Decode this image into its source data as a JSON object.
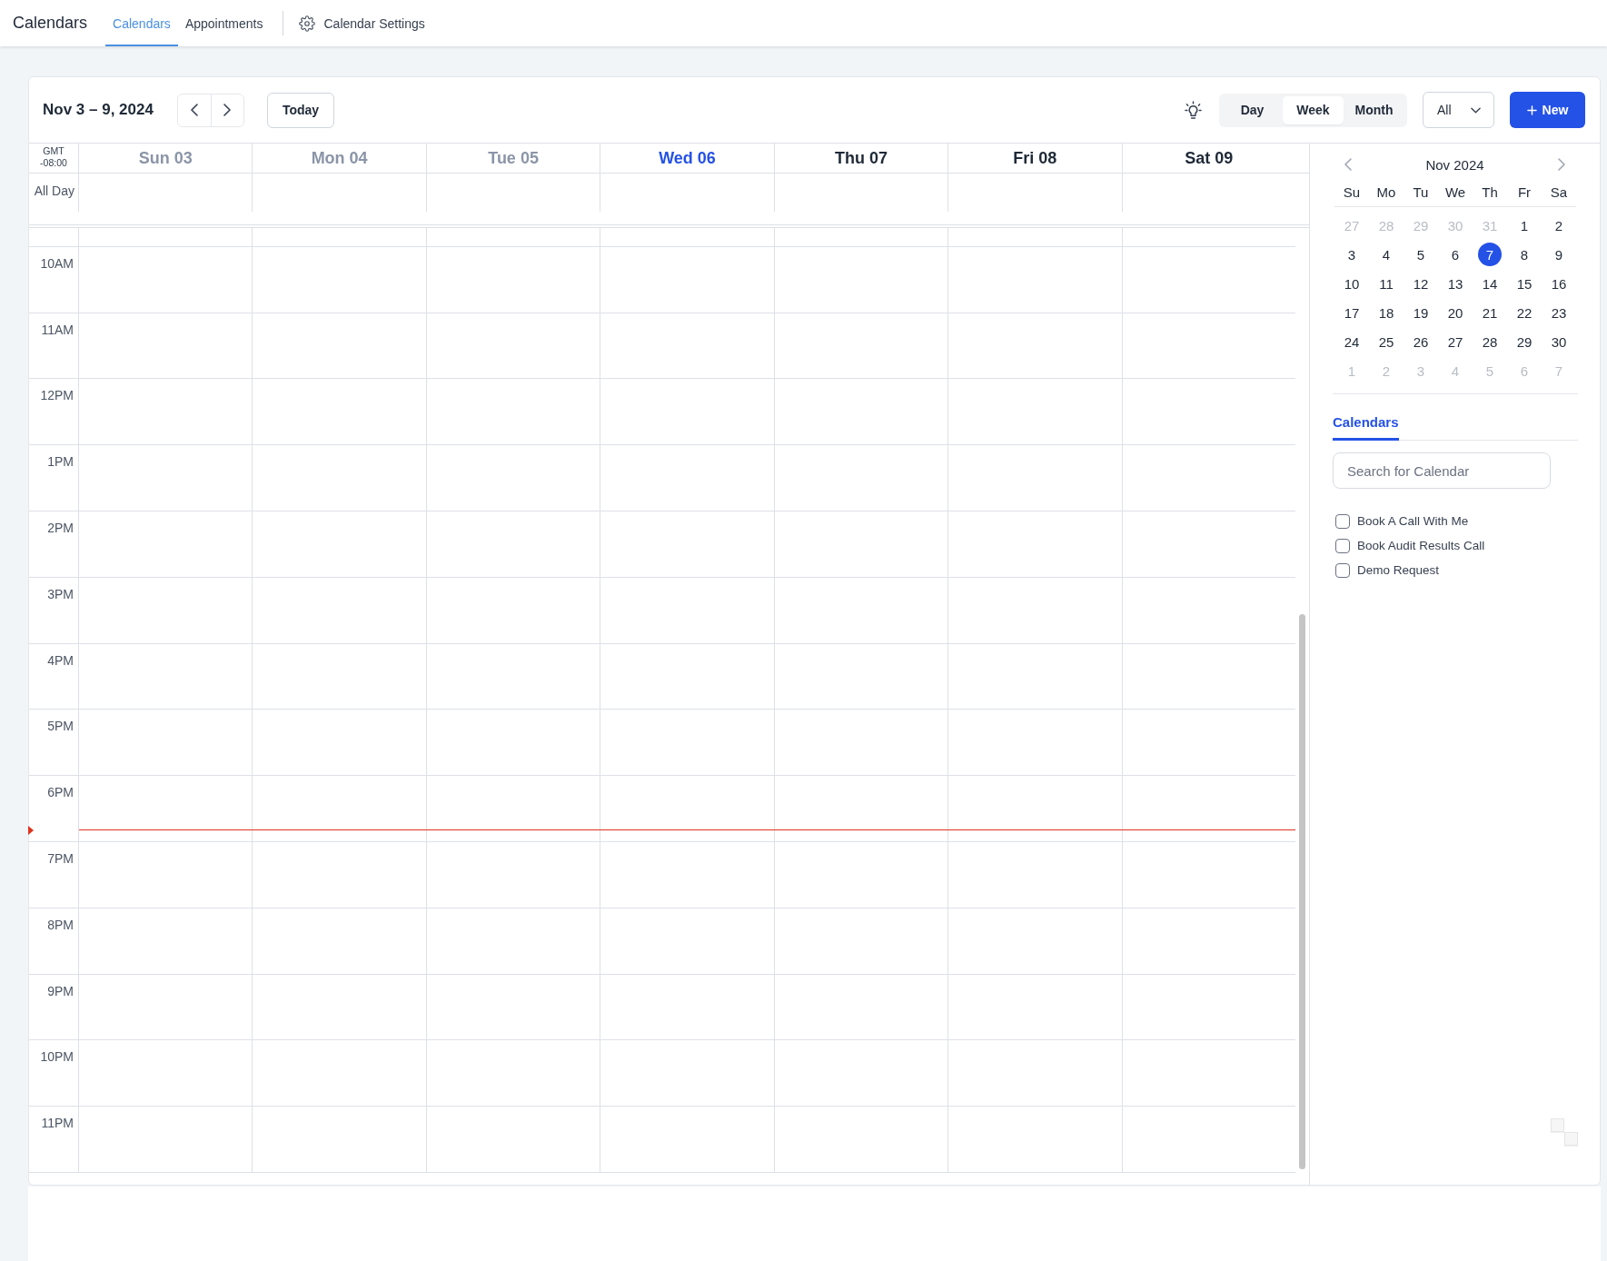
{
  "top_bar": {
    "title": "Calendars",
    "tabs": [
      {
        "label": "Calendars",
        "selected": true
      },
      {
        "label": "Appointments",
        "selected": false
      }
    ],
    "settings_link": {
      "label": "Calendar Settings"
    }
  },
  "toolbar": {
    "date_range": "Nov 3 – 9, 2024",
    "today_button": "Today",
    "views": [
      {
        "label": "Day",
        "selected": false
      },
      {
        "label": "Week",
        "selected": true
      },
      {
        "label": "Month",
        "selected": false
      }
    ],
    "filter": {
      "value": "All"
    },
    "new_button": "New"
  },
  "week_grid": {
    "timezone": {
      "name": "GMT",
      "offset": "-08:00"
    },
    "all_day_label": "All Day",
    "days": [
      {
        "label": "Sun 03",
        "past": true,
        "today": false
      },
      {
        "label": "Mon 04",
        "past": true,
        "today": false
      },
      {
        "label": "Tue 05",
        "past": true,
        "today": false
      },
      {
        "label": "Wed 06",
        "past": false,
        "today": true
      },
      {
        "label": "Thu 07",
        "past": false,
        "today": false
      },
      {
        "label": "Fri 08",
        "past": false,
        "today": false
      },
      {
        "label": "Sat 09",
        "past": false,
        "today": false
      }
    ],
    "hours": [
      {
        "label": "10AM",
        "now_line": false
      },
      {
        "label": "11AM",
        "now_line": false
      },
      {
        "label": "12PM",
        "now_line": false
      },
      {
        "label": "1PM",
        "now_line": false
      },
      {
        "label": "2PM",
        "now_line": false
      },
      {
        "label": "3PM",
        "now_line": false
      },
      {
        "label": "4PM",
        "now_line": false
      },
      {
        "label": "5PM",
        "now_line": false
      },
      {
        "label": "6PM",
        "now_line": true
      },
      {
        "label": "7PM",
        "now_line": false
      },
      {
        "label": "8PM",
        "now_line": false
      },
      {
        "label": "9PM",
        "now_line": false
      },
      {
        "label": "10PM",
        "now_line": false
      },
      {
        "label": "11PM",
        "now_line": false
      }
    ]
  },
  "mini_calendar": {
    "month": "Nov 2024",
    "weekdays": [
      "Su",
      "Mo",
      "Tu",
      "We",
      "Th",
      "Fr",
      "Sa"
    ],
    "weeks": [
      [
        {
          "label": "27",
          "outside": true,
          "selected": false
        },
        {
          "label": "28",
          "outside": true,
          "selected": false
        },
        {
          "label": "29",
          "outside": true,
          "selected": false
        },
        {
          "label": "30",
          "outside": true,
          "selected": false
        },
        {
          "label": "31",
          "outside": true,
          "selected": false
        },
        {
          "label": "1",
          "outside": false,
          "selected": false
        },
        {
          "label": "2",
          "outside": false,
          "selected": false
        }
      ],
      [
        {
          "label": "3",
          "outside": false,
          "selected": false
        },
        {
          "label": "4",
          "outside": false,
          "selected": false
        },
        {
          "label": "5",
          "outside": false,
          "selected": false
        },
        {
          "label": "6",
          "outside": false,
          "selected": false
        },
        {
          "label": "7",
          "outside": false,
          "selected": true
        },
        {
          "label": "8",
          "outside": false,
          "selected": false
        },
        {
          "label": "9",
          "outside": false,
          "selected": false
        }
      ],
      [
        {
          "label": "10",
          "outside": false,
          "selected": false
        },
        {
          "label": "11",
          "outside": false,
          "selected": false
        },
        {
          "label": "12",
          "outside": false,
          "selected": false
        },
        {
          "label": "13",
          "outside": false,
          "selected": false
        },
        {
          "label": "14",
          "outside": false,
          "selected": false
        },
        {
          "label": "15",
          "outside": false,
          "selected": false
        },
        {
          "label": "16",
          "outside": false,
          "selected": false
        }
      ],
      [
        {
          "label": "17",
          "outside": false,
          "selected": false
        },
        {
          "label": "18",
          "outside": false,
          "selected": false
        },
        {
          "label": "19",
          "outside": false,
          "selected": false
        },
        {
          "label": "20",
          "outside": false,
          "selected": false
        },
        {
          "label": "21",
          "outside": false,
          "selected": false
        },
        {
          "label": "22",
          "outside": false,
          "selected": false
        },
        {
          "label": "23",
          "outside": false,
          "selected": false
        }
      ],
      [
        {
          "label": "24",
          "outside": false,
          "selected": false
        },
        {
          "label": "25",
          "outside": false,
          "selected": false
        },
        {
          "label": "26",
          "outside": false,
          "selected": false
        },
        {
          "label": "27",
          "outside": false,
          "selected": false
        },
        {
          "label": "28",
          "outside": false,
          "selected": false
        },
        {
          "label": "29",
          "outside": false,
          "selected": false
        },
        {
          "label": "30",
          "outside": false,
          "selected": false
        }
      ],
      [
        {
          "label": "1",
          "outside": true,
          "selected": false
        },
        {
          "label": "2",
          "outside": true,
          "selected": false
        },
        {
          "label": "3",
          "outside": true,
          "selected": false
        },
        {
          "label": "4",
          "outside": true,
          "selected": false
        },
        {
          "label": "5",
          "outside": true,
          "selected": false
        },
        {
          "label": "6",
          "outside": true,
          "selected": false
        },
        {
          "label": "7",
          "outside": true,
          "selected": false
        }
      ]
    ]
  },
  "calendars_panel": {
    "tab": {
      "label": "Calendars",
      "selected": true
    },
    "search": {
      "placeholder": "Search for Calendar"
    },
    "items": [
      {
        "label": "Book A Call With Me",
        "checked": false
      },
      {
        "label": "Book Audit Results Call",
        "checked": false
      },
      {
        "label": "Demo Request",
        "checked": false
      }
    ]
  }
}
